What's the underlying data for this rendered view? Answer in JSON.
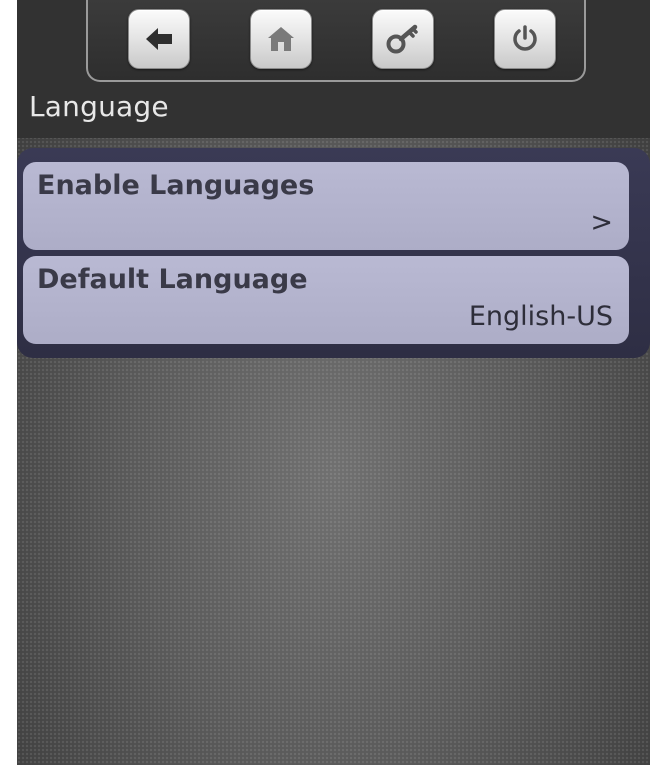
{
  "toolbar": {
    "buttons": [
      {
        "icon": "back-arrow-icon"
      },
      {
        "icon": "home-icon"
      },
      {
        "icon": "key-icon"
      },
      {
        "icon": "power-icon"
      }
    ]
  },
  "page": {
    "title": "Language"
  },
  "menu": {
    "items": [
      {
        "label": "Enable Languages",
        "value": ">"
      },
      {
        "label": "Default Language",
        "value": "English-US"
      }
    ]
  },
  "colors": {
    "header_background": "#323232",
    "menu_item_background": "#b3b3cd",
    "menu_text": "#3a3a48",
    "title_text": "#e8e8e8"
  }
}
